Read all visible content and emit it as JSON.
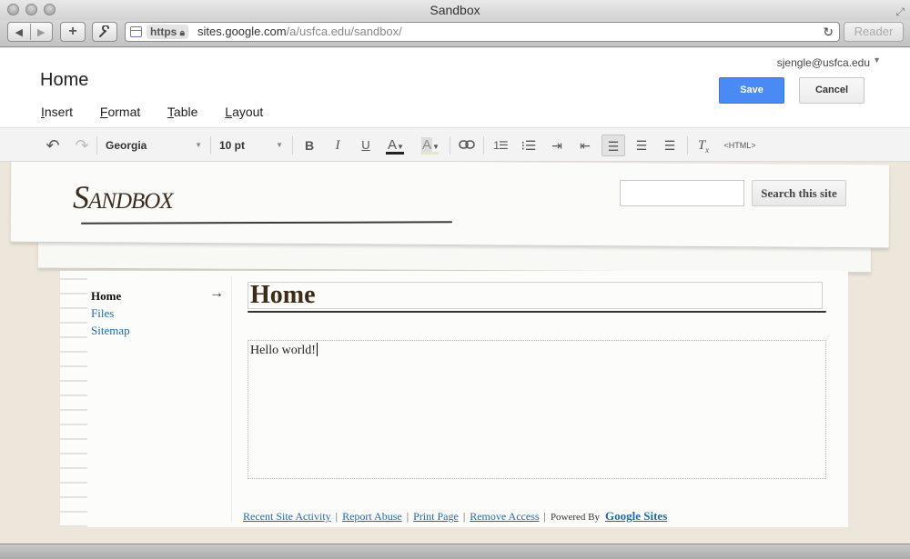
{
  "window": {
    "title": "Sandbox"
  },
  "browser": {
    "nav_back_icon": "◀",
    "nav_forward_icon": "▶",
    "add_icon": "+",
    "tools_icon": "wrench",
    "url_scheme": "https",
    "url_host": "sites.google.com",
    "url_path": "/a/usfca.edu/sandbox/",
    "reader_label": "Reader"
  },
  "editor": {
    "account": "sjengle@usfca.edu",
    "page_name": "Home",
    "menus": [
      {
        "access_key": "I",
        "rest": "nsert"
      },
      {
        "access_key": "F",
        "rest": "ormat"
      },
      {
        "access_key": "T",
        "rest": "able"
      },
      {
        "access_key": "L",
        "rest": "ayout"
      }
    ],
    "save_label": "Save",
    "cancel_label": "Cancel"
  },
  "format_toolbar": {
    "font": "Georgia",
    "size": "10 pt",
    "bold": "B",
    "italic": "I",
    "underline": "U",
    "text_color_letter": "A",
    "highlight_letter": "A",
    "html_label": "<HTML>",
    "text_color": "#222222",
    "highlight_color": "#e6e6c8",
    "active_alignment": "left"
  },
  "site": {
    "name": "Sandbox",
    "search_button": "Search this site",
    "nav": [
      {
        "label": "Home",
        "current": true
      },
      {
        "label": "Files",
        "current": false
      },
      {
        "label": "Sitemap",
        "current": false
      }
    ],
    "page_title": "Home",
    "content": "Hello world!",
    "footer": {
      "links": [
        "Recent Site Activity",
        "Report Abuse",
        "Print Page",
        "Remove Access"
      ],
      "powered_by": "Powered By",
      "google_sites": "Google Sites"
    }
  }
}
